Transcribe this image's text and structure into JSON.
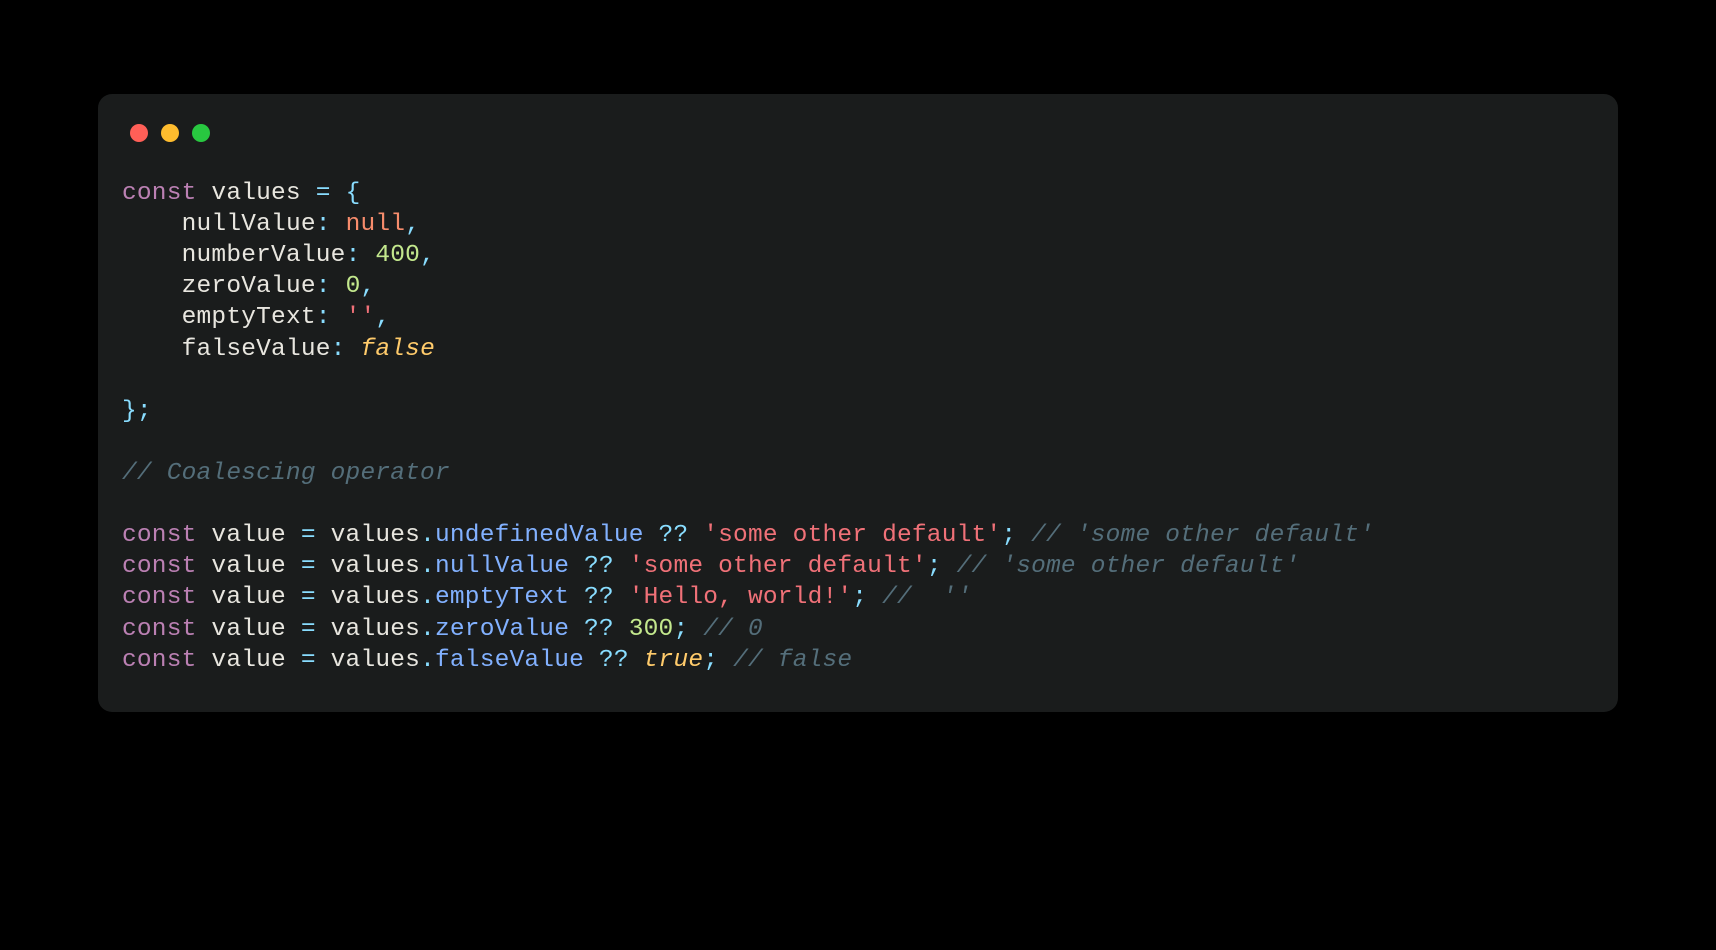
{
  "colors": {
    "bg": "#000000",
    "window_bg": "#1a1c1c",
    "traffic_red": "#ff5f57",
    "traffic_yellow": "#febc2e",
    "traffic_green": "#28c840",
    "keyword": "#bb80b3",
    "identifier": "#e8e6df",
    "member": "#82b1ff",
    "null": "#f78c6c",
    "boolean": "#ffcb6b",
    "number": "#c3e88d",
    "string": "#f07178",
    "punct": "#89ddff",
    "comment": "#546e7a"
  },
  "code": {
    "lines": [
      [
        {
          "t": "kw",
          "v": "const"
        },
        {
          "t": "punc",
          "v": " "
        },
        {
          "t": "var",
          "v": "values"
        },
        {
          "t": "punc",
          "v": " "
        },
        {
          "t": "op",
          "v": "="
        },
        {
          "t": "punc",
          "v": " "
        },
        {
          "t": "punc",
          "v": "{"
        }
      ],
      [
        {
          "t": "punc",
          "v": "    "
        },
        {
          "t": "prop",
          "v": "nullValue"
        },
        {
          "t": "op",
          "v": ":"
        },
        {
          "t": "punc",
          "v": " "
        },
        {
          "t": "null",
          "v": "null"
        },
        {
          "t": "punc",
          "v": ","
        }
      ],
      [
        {
          "t": "punc",
          "v": "    "
        },
        {
          "t": "prop",
          "v": "numberValue"
        },
        {
          "t": "op",
          "v": ":"
        },
        {
          "t": "punc",
          "v": " "
        },
        {
          "t": "num",
          "v": "400"
        },
        {
          "t": "punc",
          "v": ","
        }
      ],
      [
        {
          "t": "punc",
          "v": "    "
        },
        {
          "t": "prop",
          "v": "zeroValue"
        },
        {
          "t": "op",
          "v": ":"
        },
        {
          "t": "punc",
          "v": " "
        },
        {
          "t": "num",
          "v": "0"
        },
        {
          "t": "punc",
          "v": ","
        }
      ],
      [
        {
          "t": "punc",
          "v": "    "
        },
        {
          "t": "prop",
          "v": "emptyText"
        },
        {
          "t": "op",
          "v": ":"
        },
        {
          "t": "punc",
          "v": " "
        },
        {
          "t": "str",
          "v": "''"
        },
        {
          "t": "punc",
          "v": ","
        }
      ],
      [
        {
          "t": "punc",
          "v": "    "
        },
        {
          "t": "prop",
          "v": "falseValue"
        },
        {
          "t": "op",
          "v": ":"
        },
        {
          "t": "punc",
          "v": " "
        },
        {
          "t": "bool",
          "v": "false"
        }
      ],
      [],
      [
        {
          "t": "punc",
          "v": "};"
        }
      ],
      [],
      [
        {
          "t": "cmt",
          "v": "// Coalescing operator"
        }
      ],
      [],
      [
        {
          "t": "kw",
          "v": "const"
        },
        {
          "t": "punc",
          "v": " "
        },
        {
          "t": "var",
          "v": "value"
        },
        {
          "t": "punc",
          "v": " "
        },
        {
          "t": "op",
          "v": "="
        },
        {
          "t": "punc",
          "v": " "
        },
        {
          "t": "var",
          "v": "values"
        },
        {
          "t": "punc",
          "v": "."
        },
        {
          "t": "mem",
          "v": "undefinedValue"
        },
        {
          "t": "punc",
          "v": " "
        },
        {
          "t": "op",
          "v": "??"
        },
        {
          "t": "punc",
          "v": " "
        },
        {
          "t": "str",
          "v": "'some other default'"
        },
        {
          "t": "punc",
          "v": ";"
        },
        {
          "t": "punc",
          "v": " "
        },
        {
          "t": "cmt",
          "v": "// 'some other default'"
        }
      ],
      [
        {
          "t": "kw",
          "v": "const"
        },
        {
          "t": "punc",
          "v": " "
        },
        {
          "t": "var",
          "v": "value"
        },
        {
          "t": "punc",
          "v": " "
        },
        {
          "t": "op",
          "v": "="
        },
        {
          "t": "punc",
          "v": " "
        },
        {
          "t": "var",
          "v": "values"
        },
        {
          "t": "punc",
          "v": "."
        },
        {
          "t": "mem",
          "v": "nullValue"
        },
        {
          "t": "punc",
          "v": " "
        },
        {
          "t": "op",
          "v": "??"
        },
        {
          "t": "punc",
          "v": " "
        },
        {
          "t": "str",
          "v": "'some other default'"
        },
        {
          "t": "punc",
          "v": ";"
        },
        {
          "t": "punc",
          "v": " "
        },
        {
          "t": "cmt",
          "v": "// 'some other default'"
        }
      ],
      [
        {
          "t": "kw",
          "v": "const"
        },
        {
          "t": "punc",
          "v": " "
        },
        {
          "t": "var",
          "v": "value"
        },
        {
          "t": "punc",
          "v": " "
        },
        {
          "t": "op",
          "v": "="
        },
        {
          "t": "punc",
          "v": " "
        },
        {
          "t": "var",
          "v": "values"
        },
        {
          "t": "punc",
          "v": "."
        },
        {
          "t": "mem",
          "v": "emptyText"
        },
        {
          "t": "punc",
          "v": " "
        },
        {
          "t": "op",
          "v": "??"
        },
        {
          "t": "punc",
          "v": " "
        },
        {
          "t": "str",
          "v": "'Hello, world!'"
        },
        {
          "t": "punc",
          "v": ";"
        },
        {
          "t": "punc",
          "v": " "
        },
        {
          "t": "cmt",
          "v": "//  ''"
        }
      ],
      [
        {
          "t": "kw",
          "v": "const"
        },
        {
          "t": "punc",
          "v": " "
        },
        {
          "t": "var",
          "v": "value"
        },
        {
          "t": "punc",
          "v": " "
        },
        {
          "t": "op",
          "v": "="
        },
        {
          "t": "punc",
          "v": " "
        },
        {
          "t": "var",
          "v": "values"
        },
        {
          "t": "punc",
          "v": "."
        },
        {
          "t": "mem",
          "v": "zeroValue"
        },
        {
          "t": "punc",
          "v": " "
        },
        {
          "t": "op",
          "v": "??"
        },
        {
          "t": "punc",
          "v": " "
        },
        {
          "t": "num",
          "v": "300"
        },
        {
          "t": "punc",
          "v": ";"
        },
        {
          "t": "punc",
          "v": " "
        },
        {
          "t": "cmt",
          "v": "// 0"
        }
      ],
      [
        {
          "t": "kw",
          "v": "const"
        },
        {
          "t": "punc",
          "v": " "
        },
        {
          "t": "var",
          "v": "value"
        },
        {
          "t": "punc",
          "v": " "
        },
        {
          "t": "op",
          "v": "="
        },
        {
          "t": "punc",
          "v": " "
        },
        {
          "t": "var",
          "v": "values"
        },
        {
          "t": "punc",
          "v": "."
        },
        {
          "t": "mem",
          "v": "falseValue"
        },
        {
          "t": "punc",
          "v": " "
        },
        {
          "t": "op",
          "v": "??"
        },
        {
          "t": "punc",
          "v": " "
        },
        {
          "t": "bool",
          "v": "true"
        },
        {
          "t": "punc",
          "v": ";"
        },
        {
          "t": "punc",
          "v": " "
        },
        {
          "t": "cmt",
          "v": "// false"
        }
      ]
    ]
  }
}
